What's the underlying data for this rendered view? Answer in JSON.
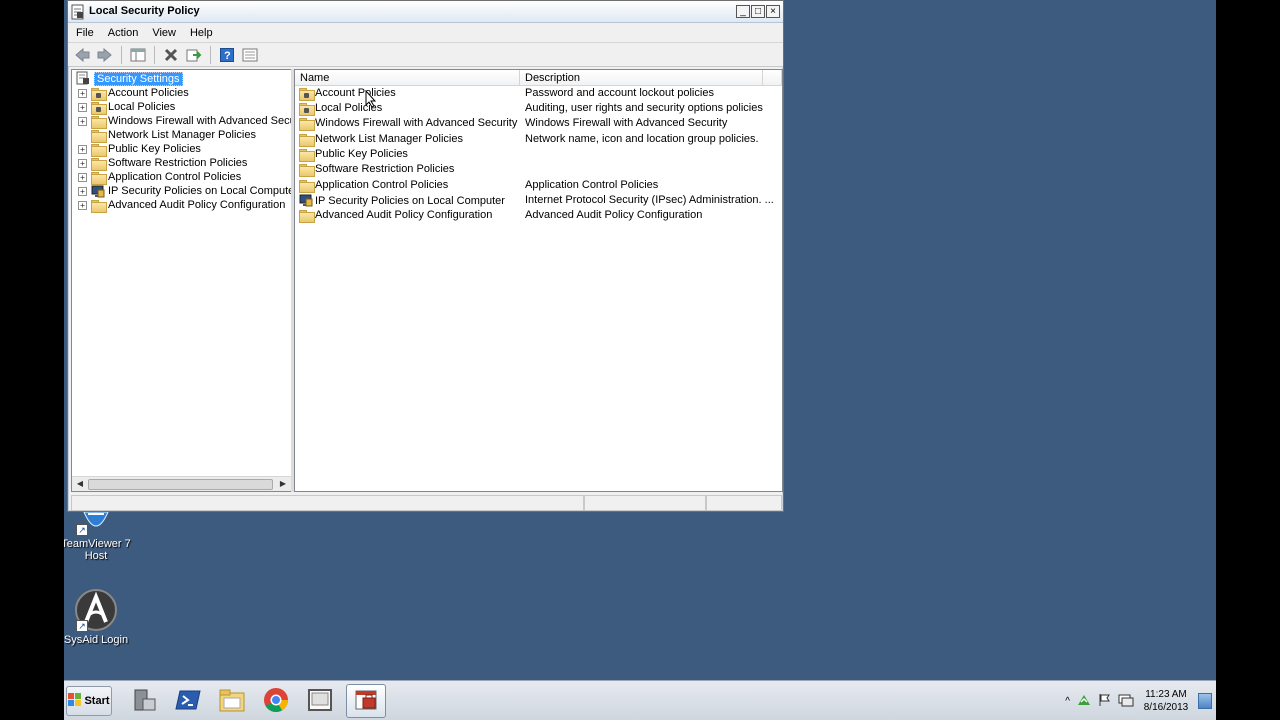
{
  "window": {
    "title": "Local Security Policy",
    "caption_buttons": [
      "_",
      "□",
      "×"
    ]
  },
  "menu": [
    "File",
    "Action",
    "View",
    "Help"
  ],
  "toolbar_icons": [
    "back-icon",
    "forward-icon",
    "show-hide-tree-icon",
    "delete-icon",
    "export-icon",
    "help-icon",
    "properties-icon"
  ],
  "tree": {
    "root": "Security Settings",
    "items": [
      {
        "label": "Account Policies",
        "expandable": true,
        "icon": "folder-lock-icon"
      },
      {
        "label": "Local Policies",
        "expandable": true,
        "icon": "folder-lock-icon"
      },
      {
        "label": "Windows Firewall with Advanced Security",
        "expandable": true,
        "icon": "folder-icon"
      },
      {
        "label": "Network List Manager Policies",
        "expandable": false,
        "icon": "folder-icon"
      },
      {
        "label": "Public Key Policies",
        "expandable": true,
        "icon": "folder-icon"
      },
      {
        "label": "Software Restriction Policies",
        "expandable": true,
        "icon": "folder-icon"
      },
      {
        "label": "Application Control Policies",
        "expandable": true,
        "icon": "folder-icon"
      },
      {
        "label": "IP Security Policies on Local Computer",
        "expandable": true,
        "icon": "ip-security-icon"
      },
      {
        "label": "Advanced Audit Policy Configuration",
        "expandable": true,
        "icon": "folder-icon"
      }
    ]
  },
  "list": {
    "columns": [
      "Name",
      "Description"
    ],
    "rows": [
      {
        "name": "Account Policies",
        "description": "Password and account lockout policies"
      },
      {
        "name": "Local Policies",
        "description": "Auditing, user rights and security options policies"
      },
      {
        "name": "Windows Firewall with Advanced Security",
        "description": "Windows Firewall with Advanced Security"
      },
      {
        "name": "Network List Manager Policies",
        "description": "Network name, icon and location group policies."
      },
      {
        "name": "Public Key Policies",
        "description": ""
      },
      {
        "name": "Software Restriction Policies",
        "description": ""
      },
      {
        "name": "Application Control Policies",
        "description": "Application Control Policies"
      },
      {
        "name": "IP Security Policies on Local Computer",
        "description": "Internet Protocol Security (IPsec) Administration. ..."
      },
      {
        "name": "Advanced Audit Policy Configuration",
        "description": "Advanced Audit Policy Configuration"
      }
    ]
  },
  "desktop_icons": [
    {
      "label": "TeamViewer 7 Host",
      "icon": "teamviewer-icon"
    },
    {
      "label": "SysAid Login",
      "icon": "sysaid-icon"
    }
  ],
  "taskbar": {
    "start_label": "Start",
    "apps": [
      "server-manager-icon",
      "powershell-icon",
      "explorer-icon",
      "chrome-icon",
      "media-icon",
      "local-security-policy-icon"
    ],
    "clock_time": "11:23 AM",
    "clock_date": "8/16/2013"
  },
  "colors": {
    "desktop": "#3d5a7f",
    "selection": "#3399ff"
  }
}
